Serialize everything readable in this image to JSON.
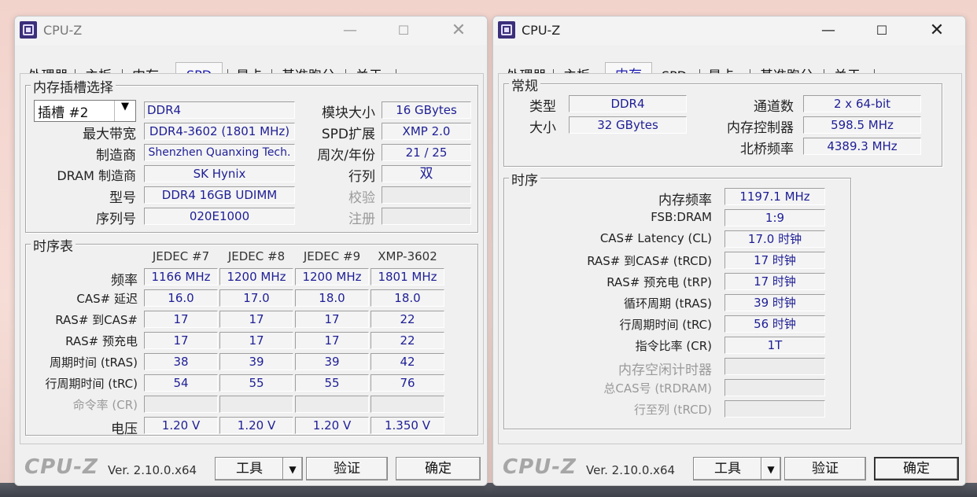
{
  "window_left": {
    "title": "CPU-Z",
    "tabs": [
      "处理器",
      "主板",
      "内存",
      "SPD",
      "显卡",
      "基准跑分",
      "关于"
    ],
    "active_tab": "SPD",
    "slot_group": {
      "title": "内存插槽选择",
      "slot_selected": "插槽 #2",
      "memory_type": "DDR4",
      "module_size_label": "模块大小",
      "module_size": "16 GBytes",
      "max_bandwidth_label": "最大带宽",
      "max_bandwidth": "DDR4-3602 (1801 MHz)",
      "spd_ext_label": "SPD扩展",
      "spd_ext": "XMP 2.0",
      "manufacturer_label": "制造商",
      "manufacturer": "Shenzhen Quanxing Tech.",
      "week_year_label": "周次/年份",
      "week_year": "21 / 25",
      "dram_mfr_label": "DRAM 制造商",
      "dram_mfr": "SK Hynix",
      "ranks_label": "行列",
      "ranks": "双",
      "part_label": "型号",
      "part": "DDR4 16GB UDIMM",
      "correction_label": "校验",
      "correction": "",
      "serial_label": "序列号",
      "serial": "020E1000",
      "registered_label": "注册",
      "registered": ""
    },
    "timing_table": {
      "title": "时序表",
      "columns": [
        "JEDEC #7",
        "JEDEC #8",
        "JEDEC #9",
        "XMP-3602"
      ],
      "rows": [
        {
          "label": "频率",
          "values": [
            "1166 MHz",
            "1200 MHz",
            "1200 MHz",
            "1801 MHz"
          ]
        },
        {
          "label": "CAS# 延迟",
          "values": [
            "16.0",
            "17.0",
            "18.0",
            "18.0"
          ]
        },
        {
          "label": "RAS# 到CAS#",
          "values": [
            "17",
            "17",
            "17",
            "22"
          ]
        },
        {
          "label": "RAS# 预充电",
          "values": [
            "17",
            "17",
            "17",
            "22"
          ]
        },
        {
          "label": "周期时间 (tRAS)",
          "values": [
            "38",
            "39",
            "39",
            "42"
          ]
        },
        {
          "label": "行周期时间 (tRC)",
          "values": [
            "54",
            "55",
            "55",
            "76"
          ]
        },
        {
          "label": "命令率 (CR)",
          "values": [
            "",
            "",
            "",
            ""
          ]
        },
        {
          "label": "电压",
          "values": [
            "1.20 V",
            "1.20 V",
            "1.20 V",
            "1.350 V"
          ]
        }
      ]
    },
    "footer": {
      "logo": "CPU-Z",
      "version": "Ver. 2.10.0.x64",
      "tools": "工具",
      "validate": "验证",
      "ok": "确定"
    }
  },
  "window_right": {
    "title": "CPU-Z",
    "tabs": [
      "处理器",
      "主板",
      "内存",
      "SPD",
      "显卡",
      "基准跑分",
      "关于"
    ],
    "active_tab": "内存",
    "general": {
      "title": "常规",
      "type_label": "类型",
      "type": "DDR4",
      "size_label": "大小",
      "size": "32 GBytes",
      "channels_label": "通道数",
      "channels": "2 x 64-bit",
      "mem_ctrl_label": "内存控制器",
      "mem_ctrl": "598.5 MHz",
      "nb_freq_label": "北桥频率",
      "nb_freq": "4389.3 MHz"
    },
    "timings": {
      "title": "时序",
      "rows": [
        {
          "label": "内存频率",
          "value": "1197.1 MHz",
          "dim": false
        },
        {
          "label": "FSB:DRAM",
          "value": "1:9",
          "dim": false
        },
        {
          "label": "CAS# Latency (CL)",
          "value": "17.0 时钟",
          "dim": false
        },
        {
          "label": "RAS# 到CAS# (tRCD)",
          "value": "17 时钟",
          "dim": false
        },
        {
          "label": "RAS# 预充电 (tRP)",
          "value": "17 时钟",
          "dim": false
        },
        {
          "label": "循环周期 (tRAS)",
          "value": "39 时钟",
          "dim": false
        },
        {
          "label": "行周期时间 (tRC)",
          "value": "56 时钟",
          "dim": false
        },
        {
          "label": "指令比率 (CR)",
          "value": "1T",
          "dim": false
        },
        {
          "label": "内存空闲计时器",
          "value": "",
          "dim": true
        },
        {
          "label": "总CAS号 (tRDRAM)",
          "value": "",
          "dim": true
        },
        {
          "label": "行至列 (tRCD)",
          "value": "",
          "dim": true
        }
      ]
    },
    "footer": {
      "logo": "CPU-Z",
      "version": "Ver. 2.10.0.x64",
      "tools": "工具",
      "validate": "验证",
      "ok": "确定"
    }
  },
  "icons": {
    "minimize": "minimize-icon",
    "maximize": "maximize-icon",
    "close": "close-icon",
    "dropdown": "chevron-down-icon"
  },
  "colors": {
    "value_text": "#1e1e96",
    "active_tab_text": "#1a1ab0",
    "window_bg": "#f0f0f0",
    "desktop_bg": "#f4d8d1"
  }
}
